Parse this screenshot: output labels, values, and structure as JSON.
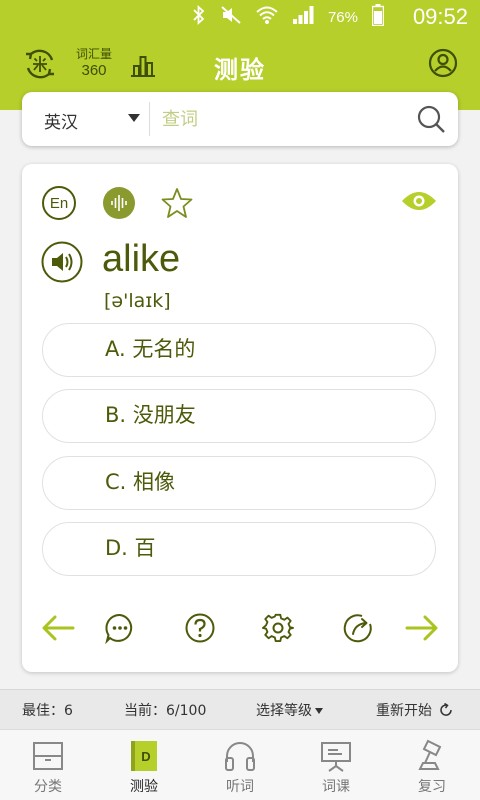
{
  "status_bar": {
    "battery_percent": "76%",
    "time": "09:52"
  },
  "header": {
    "title": "测验",
    "vocab_label": "词汇量",
    "vocab_count": "360"
  },
  "search": {
    "dict_lang": "英汉",
    "placeholder": "查词"
  },
  "quiz": {
    "lang_badge": "En",
    "word": "alike",
    "phonetic": "[ə'laɪk]",
    "options": [
      {
        "label": "A. 无名的"
      },
      {
        "label": "B. 没朋友"
      },
      {
        "label": "C. 相像"
      },
      {
        "label": "D. 百"
      }
    ]
  },
  "stats": {
    "best": "最佳：6",
    "current": "当前：6/100",
    "level": "选择等级",
    "restart": "重新开始"
  },
  "nav": [
    {
      "label": "分类",
      "icon": "folder-icon"
    },
    {
      "label": "测验",
      "icon": "quiz-book-icon",
      "active": true
    },
    {
      "label": "听词",
      "icon": "headphones-icon"
    },
    {
      "label": "词课",
      "icon": "lesson-board-icon"
    },
    {
      "label": "复习",
      "icon": "lamp-icon"
    }
  ],
  "colors": {
    "accent": "#b6cf2b",
    "dark_olive": "#4b5b0a",
    "arrow_green": "#a8c41e"
  }
}
